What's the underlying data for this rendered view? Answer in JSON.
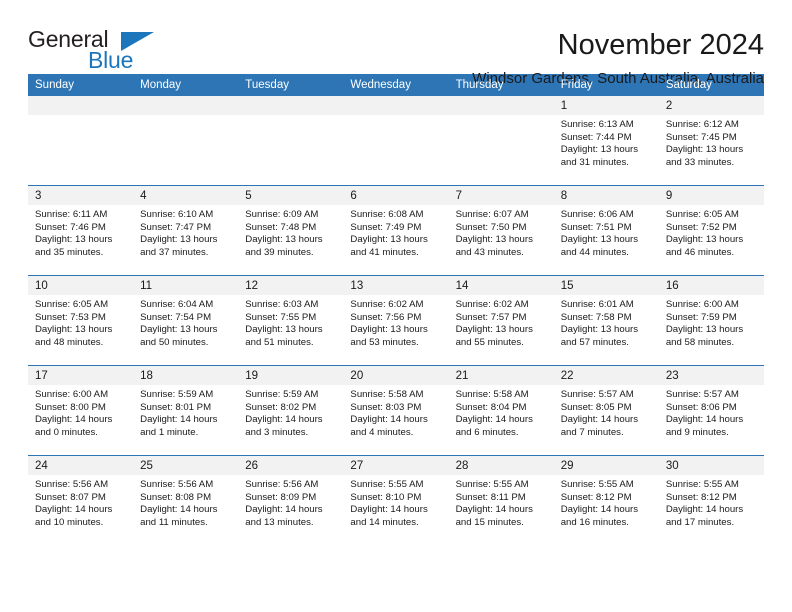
{
  "brand": {
    "name_part1": "General",
    "name_part2": "Blue",
    "triangle_color": "#1c76bc",
    "blue_text_color": "#1c76bc"
  },
  "header": {
    "month_title": "November 2024",
    "location": "Windsor Gardens, South Australia, Australia"
  },
  "theme": {
    "header_blue": "#2e75b6",
    "daynum_band": "#f2f2f2",
    "text": "#1a1a1a"
  },
  "calendar": {
    "weekday_headers": [
      "Sunday",
      "Monday",
      "Tuesday",
      "Wednesday",
      "Thursday",
      "Friday",
      "Saturday"
    ],
    "weeks": [
      [
        {
          "day": "",
          "empty": true
        },
        {
          "day": "",
          "empty": true
        },
        {
          "day": "",
          "empty": true
        },
        {
          "day": "",
          "empty": true
        },
        {
          "day": "",
          "empty": true
        },
        {
          "day": "1",
          "sunrise": "Sunrise: 6:13 AM",
          "sunset": "Sunset: 7:44 PM",
          "daylight1": "Daylight: 13 hours",
          "daylight2": "and 31 minutes."
        },
        {
          "day": "2",
          "sunrise": "Sunrise: 6:12 AM",
          "sunset": "Sunset: 7:45 PM",
          "daylight1": "Daylight: 13 hours",
          "daylight2": "and 33 minutes."
        }
      ],
      [
        {
          "day": "3",
          "sunrise": "Sunrise: 6:11 AM",
          "sunset": "Sunset: 7:46 PM",
          "daylight1": "Daylight: 13 hours",
          "daylight2": "and 35 minutes."
        },
        {
          "day": "4",
          "sunrise": "Sunrise: 6:10 AM",
          "sunset": "Sunset: 7:47 PM",
          "daylight1": "Daylight: 13 hours",
          "daylight2": "and 37 minutes."
        },
        {
          "day": "5",
          "sunrise": "Sunrise: 6:09 AM",
          "sunset": "Sunset: 7:48 PM",
          "daylight1": "Daylight: 13 hours",
          "daylight2": "and 39 minutes."
        },
        {
          "day": "6",
          "sunrise": "Sunrise: 6:08 AM",
          "sunset": "Sunset: 7:49 PM",
          "daylight1": "Daylight: 13 hours",
          "daylight2": "and 41 minutes."
        },
        {
          "day": "7",
          "sunrise": "Sunrise: 6:07 AM",
          "sunset": "Sunset: 7:50 PM",
          "daylight1": "Daylight: 13 hours",
          "daylight2": "and 43 minutes."
        },
        {
          "day": "8",
          "sunrise": "Sunrise: 6:06 AM",
          "sunset": "Sunset: 7:51 PM",
          "daylight1": "Daylight: 13 hours",
          "daylight2": "and 44 minutes."
        },
        {
          "day": "9",
          "sunrise": "Sunrise: 6:05 AM",
          "sunset": "Sunset: 7:52 PM",
          "daylight1": "Daylight: 13 hours",
          "daylight2": "and 46 minutes."
        }
      ],
      [
        {
          "day": "10",
          "sunrise": "Sunrise: 6:05 AM",
          "sunset": "Sunset: 7:53 PM",
          "daylight1": "Daylight: 13 hours",
          "daylight2": "and 48 minutes."
        },
        {
          "day": "11",
          "sunrise": "Sunrise: 6:04 AM",
          "sunset": "Sunset: 7:54 PM",
          "daylight1": "Daylight: 13 hours",
          "daylight2": "and 50 minutes."
        },
        {
          "day": "12",
          "sunrise": "Sunrise: 6:03 AM",
          "sunset": "Sunset: 7:55 PM",
          "daylight1": "Daylight: 13 hours",
          "daylight2": "and 51 minutes."
        },
        {
          "day": "13",
          "sunrise": "Sunrise: 6:02 AM",
          "sunset": "Sunset: 7:56 PM",
          "daylight1": "Daylight: 13 hours",
          "daylight2": "and 53 minutes."
        },
        {
          "day": "14",
          "sunrise": "Sunrise: 6:02 AM",
          "sunset": "Sunset: 7:57 PM",
          "daylight1": "Daylight: 13 hours",
          "daylight2": "and 55 minutes."
        },
        {
          "day": "15",
          "sunrise": "Sunrise: 6:01 AM",
          "sunset": "Sunset: 7:58 PM",
          "daylight1": "Daylight: 13 hours",
          "daylight2": "and 57 minutes."
        },
        {
          "day": "16",
          "sunrise": "Sunrise: 6:00 AM",
          "sunset": "Sunset: 7:59 PM",
          "daylight1": "Daylight: 13 hours",
          "daylight2": "and 58 minutes."
        }
      ],
      [
        {
          "day": "17",
          "sunrise": "Sunrise: 6:00 AM",
          "sunset": "Sunset: 8:00 PM",
          "daylight1": "Daylight: 14 hours",
          "daylight2": "and 0 minutes."
        },
        {
          "day": "18",
          "sunrise": "Sunrise: 5:59 AM",
          "sunset": "Sunset: 8:01 PM",
          "daylight1": "Daylight: 14 hours",
          "daylight2": "and 1 minute."
        },
        {
          "day": "19",
          "sunrise": "Sunrise: 5:59 AM",
          "sunset": "Sunset: 8:02 PM",
          "daylight1": "Daylight: 14 hours",
          "daylight2": "and 3 minutes."
        },
        {
          "day": "20",
          "sunrise": "Sunrise: 5:58 AM",
          "sunset": "Sunset: 8:03 PM",
          "daylight1": "Daylight: 14 hours",
          "daylight2": "and 4 minutes."
        },
        {
          "day": "21",
          "sunrise": "Sunrise: 5:58 AM",
          "sunset": "Sunset: 8:04 PM",
          "daylight1": "Daylight: 14 hours",
          "daylight2": "and 6 minutes."
        },
        {
          "day": "22",
          "sunrise": "Sunrise: 5:57 AM",
          "sunset": "Sunset: 8:05 PM",
          "daylight1": "Daylight: 14 hours",
          "daylight2": "and 7 minutes."
        },
        {
          "day": "23",
          "sunrise": "Sunrise: 5:57 AM",
          "sunset": "Sunset: 8:06 PM",
          "daylight1": "Daylight: 14 hours",
          "daylight2": "and 9 minutes."
        }
      ],
      [
        {
          "day": "24",
          "sunrise": "Sunrise: 5:56 AM",
          "sunset": "Sunset: 8:07 PM",
          "daylight1": "Daylight: 14 hours",
          "daylight2": "and 10 minutes."
        },
        {
          "day": "25",
          "sunrise": "Sunrise: 5:56 AM",
          "sunset": "Sunset: 8:08 PM",
          "daylight1": "Daylight: 14 hours",
          "daylight2": "and 11 minutes."
        },
        {
          "day": "26",
          "sunrise": "Sunrise: 5:56 AM",
          "sunset": "Sunset: 8:09 PM",
          "daylight1": "Daylight: 14 hours",
          "daylight2": "and 13 minutes."
        },
        {
          "day": "27",
          "sunrise": "Sunrise: 5:55 AM",
          "sunset": "Sunset: 8:10 PM",
          "daylight1": "Daylight: 14 hours",
          "daylight2": "and 14 minutes."
        },
        {
          "day": "28",
          "sunrise": "Sunrise: 5:55 AM",
          "sunset": "Sunset: 8:11 PM",
          "daylight1": "Daylight: 14 hours",
          "daylight2": "and 15 minutes."
        },
        {
          "day": "29",
          "sunrise": "Sunrise: 5:55 AM",
          "sunset": "Sunset: 8:12 PM",
          "daylight1": "Daylight: 14 hours",
          "daylight2": "and 16 minutes."
        },
        {
          "day": "30",
          "sunrise": "Sunrise: 5:55 AM",
          "sunset": "Sunset: 8:12 PM",
          "daylight1": "Daylight: 14 hours",
          "daylight2": "and 17 minutes."
        }
      ]
    ]
  }
}
